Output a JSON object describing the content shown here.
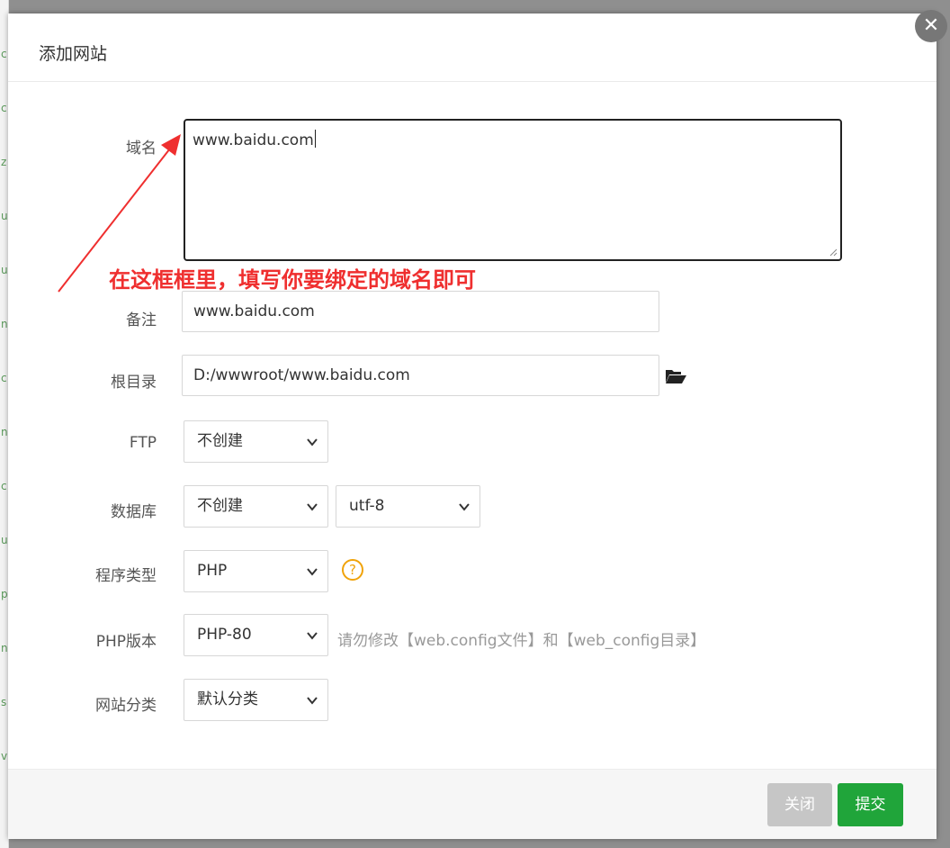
{
  "dialog": {
    "title": "添加网站",
    "close_icon": "close-icon"
  },
  "form": {
    "domain": {
      "label": "域名",
      "value": "www.baidu.com"
    },
    "remark": {
      "label": "备注",
      "value": "www.baidu.com"
    },
    "root_dir": {
      "label": "根目录",
      "value": "D:/wwwroot/www.baidu.com",
      "icon": "folder-open-icon"
    },
    "ftp": {
      "label": "FTP",
      "selected": "不创建"
    },
    "database": {
      "label": "数据库",
      "selected": "不创建",
      "charset": "utf-8"
    },
    "program_type": {
      "label": "程序类型",
      "selected": "PHP",
      "help_icon": "question-circle-icon",
      "help_glyph": "?"
    },
    "php_version": {
      "label": "PHP版本",
      "selected": "PHP-80",
      "hint": "请勿修改【web.config文件】和【web_config目录】"
    },
    "site_category": {
      "label": "网站分类",
      "selected": "默认分类"
    }
  },
  "annotation": {
    "text": "在这框框里，填写你要绑定的域名即可",
    "color": "#ef2f2f"
  },
  "footer": {
    "close_label": "关闭",
    "submit_label": "提交"
  },
  "colors": {
    "accent": "#20a53a",
    "help": "#f0a30a",
    "annotation": "#ef2f2f"
  },
  "background_strip": [
    "c",
    "c",
    "z",
    "u",
    "u",
    "n",
    "c",
    "n",
    "c",
    "u",
    "p",
    "n",
    "s",
    "v"
  ]
}
